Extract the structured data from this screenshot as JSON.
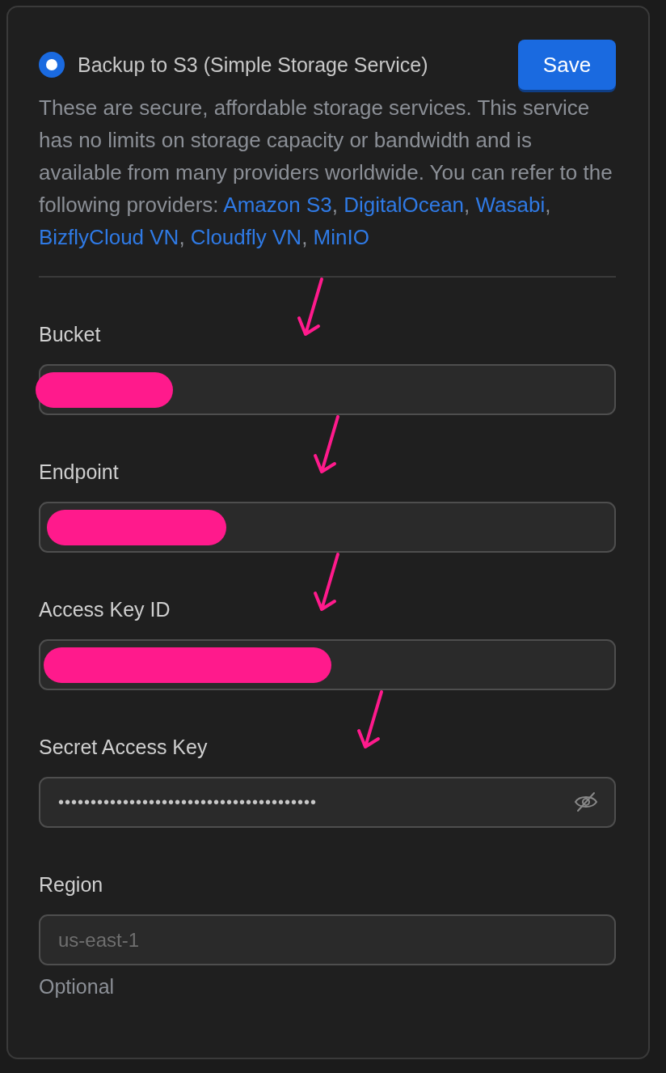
{
  "option": {
    "label": "Backup to S3 (Simple Storage Service)",
    "selected": true
  },
  "save_button": "Save",
  "description": {
    "text": "These are secure, affordable storage services. This service has no limits on storage capacity or bandwidth and is available from many providers worldwide. You can refer to the following providers: ",
    "links": [
      {
        "text": "Amazon S3",
        "separator": ", "
      },
      {
        "text": "DigitalOcean",
        "separator": ", "
      },
      {
        "text": "Wasabi",
        "separator": ", "
      },
      {
        "text": "BizflyCloud VN",
        "separator": ", "
      },
      {
        "text": "Cloudfly VN",
        "separator": ", "
      },
      {
        "text": "MinIO"
      }
    ]
  },
  "fields": [
    {
      "label": "Bucket",
      "kind": "text",
      "redacted": true,
      "marked": true
    },
    {
      "label": "Endpoint",
      "kind": "text",
      "redacted": true,
      "marked": true
    },
    {
      "label": "Access Key ID",
      "kind": "text",
      "redacted": true,
      "marked": true
    },
    {
      "label": "Secret Access Key",
      "kind": "password",
      "value": "••••••••••••••••••••••••••••••••••••••••",
      "marked": true
    },
    {
      "label": "Region",
      "kind": "text",
      "placeholder": "us-east-1",
      "hint": "Optional"
    }
  ]
}
